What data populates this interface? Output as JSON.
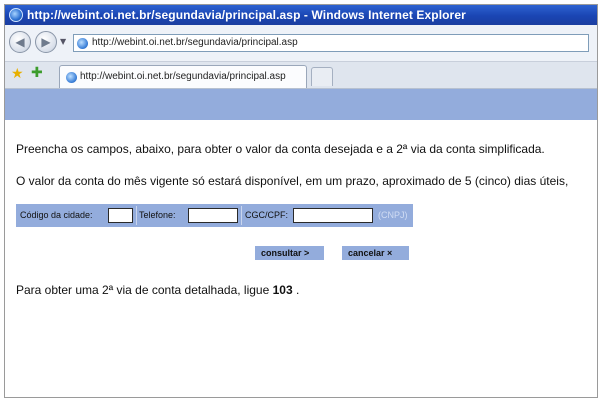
{
  "window": {
    "title": "http://webint.oi.net.br/segundavia/principal.asp - Windows Internet Explorer"
  },
  "navbar": {
    "back_icon": "back-arrow-icon",
    "forward_icon": "forward-arrow-icon",
    "dropdown_icon": "dropdown-arrow-icon",
    "address_url": "http://webint.oi.net.br/segundavia/principal.asp"
  },
  "tabs": {
    "active_label": "http://webint.oi.net.br/segundavia/principal.asp"
  },
  "page": {
    "intro": "Preencha os campos, abaixo, para obter o valor da conta desejada e a 2ª via da conta simplificada.",
    "notice": "O valor da conta do mês vigente só estará disponível, em um prazo, aproximado de 5 (cinco) dias úteis,",
    "form": {
      "city_code_label": "Código da cidade:",
      "city_code_value": "",
      "phone_label": "Telefone:",
      "phone_value": "",
      "cgc_cpf_label": "CGC/CPF:",
      "cgc_cpf_value": "",
      "cnpj_hint": "(CNPJ)"
    },
    "buttons": {
      "consultar": "consultar >",
      "cancelar": "cancelar ×"
    },
    "footer": {
      "text_before": "Para obter uma 2ª via de conta detalhada, ligue ",
      "phone_number": "103",
      "text_after": " ."
    }
  },
  "colors": {
    "title_bar": "#1a45b3",
    "form_bar": "#93acdc",
    "band": "#93acdc"
  }
}
